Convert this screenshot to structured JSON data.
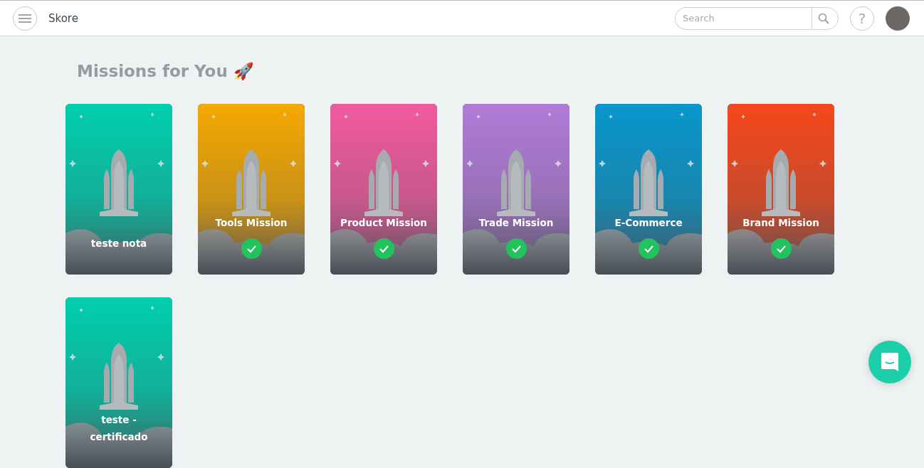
{
  "header": {
    "app_name": "Skore",
    "search": {
      "placeholder": "Search"
    },
    "help_label": "?"
  },
  "heading": "Missions for You 🚀",
  "missions": [
    {
      "title": "teste nota",
      "completed": false,
      "color": "#00cfae"
    },
    {
      "title": "Tools Mission",
      "completed": true,
      "color": "#f5a800"
    },
    {
      "title": "Product Mission",
      "completed": true,
      "color": "#f25a9f"
    },
    {
      "title": "Trade Mission",
      "completed": true,
      "color": "#b27bd8"
    },
    {
      "title": "E-Commerce",
      "completed": true,
      "color": "#0897cc"
    },
    {
      "title": "Brand Mission",
      "completed": true,
      "color": "#f5481c"
    },
    {
      "title": "teste - certificado",
      "completed": false,
      "color": "#00cfae"
    }
  ]
}
